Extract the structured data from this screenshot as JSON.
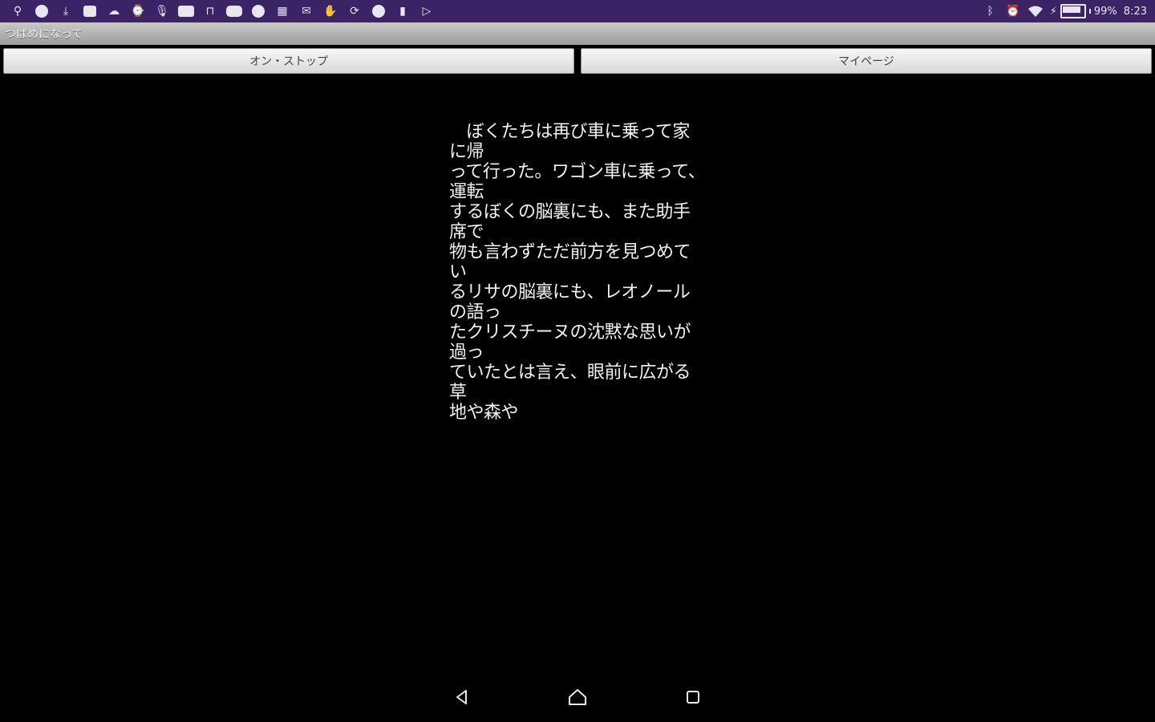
{
  "status_bar": {
    "left_icons": [
      "usb-icon",
      "globe-icon",
      "download-icon",
      "save-icon",
      "cloud-icon",
      "watch-icon",
      "mic-off-icon",
      "news-icon",
      "car-icon",
      "youtube-icon",
      "globe-icon",
      "calendar-icon",
      "mail-icon",
      "hand-icon",
      "sync-icon",
      "alert-icon",
      "flashlight-icon",
      "play-store-icon"
    ],
    "right_icons": [
      "bluetooth-icon",
      "alarm-icon",
      "wifi-icon"
    ],
    "battery_percent_label": "99%",
    "battery_level": 0.99,
    "time": "8:23"
  },
  "app_bar": {
    "title": "つばめになって"
  },
  "buttons": {
    "on_stop_label": "オン・ストップ",
    "my_page_label": "マイページ"
  },
  "story": {
    "text": "　ぼくたちは再び車に乗って家に帰\nって行った。ワゴン車に乗って、運転\nするぼくの脳裏にも、また助手席で\n物も言わずただ前方を見つめてい\nるリサの脳裏にも、レオノールの語っ\nたクリスチーヌの沈黙な思いが過っ\nていたとは言え、眼前に広がる草\n地や森や"
  },
  "nav_bar": {
    "icons": [
      "back-icon",
      "home-icon",
      "recents-icon"
    ]
  },
  "colors": {
    "status_bar_bg": "#3b2466",
    "content_bg": "#000000",
    "text": "#f1f1f1"
  }
}
